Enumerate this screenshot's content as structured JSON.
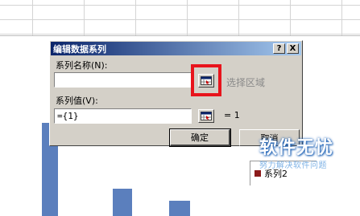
{
  "dialog": {
    "title": "编辑数据系列",
    "help_label": "?",
    "close_label": "X",
    "series_name_label": "系列名称(N):",
    "series_name_value": "",
    "series_value_label": "系列值(V):",
    "series_value_value": "={1}",
    "select_region_hint": "选择区域",
    "value_preview": "= 1",
    "ok_label": "确定",
    "cancel_label": "取消"
  },
  "chart": {
    "legend_label": "系列2",
    "bar_color": "#5b7fbd",
    "legend_color": "#8b1a1a"
  },
  "watermark": {
    "title": "软件无忧",
    "subtitle": "努力解决软件问题"
  },
  "colors": {
    "highlight": "#e8141c",
    "titlebar_start": "#0a246a",
    "titlebar_end": "#a6caf0"
  }
}
